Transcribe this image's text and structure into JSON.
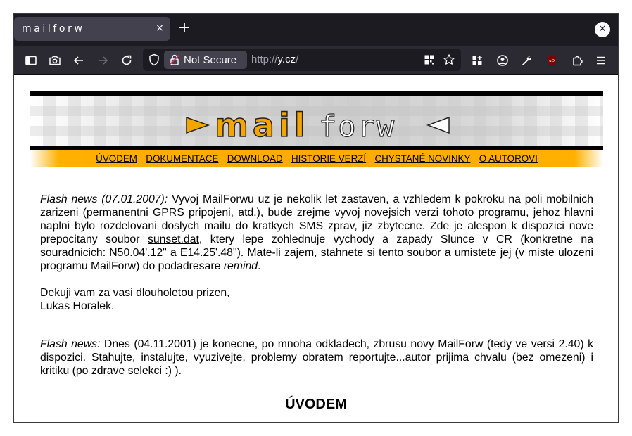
{
  "browser": {
    "tab_title": "mailforw",
    "tab_close": "×",
    "new_tab": "+",
    "window_close": "✕",
    "security_label": "Not Secure",
    "url_scheme": "http://",
    "url_host": "y.cz",
    "url_path": "/",
    "icons": [
      "sidebar-icon",
      "screenshot-icon",
      "back-icon",
      "forward-icon",
      "reload-icon",
      "shield-icon",
      "lock-icon",
      "qr-icon",
      "bookmark-star-icon",
      "extensions-grid-icon",
      "account-icon",
      "wrench-icon",
      "ublock-icon",
      "puzzle-icon",
      "menu-icon"
    ],
    "ublock_badge": "uO"
  },
  "banner": {
    "logo_bold": "mail",
    "logo_light": "forw",
    "colors": {
      "accent": "#ffaa00",
      "bar": "#000000"
    }
  },
  "menu": {
    "items": [
      "ÚVODEM",
      "DOKUMENTACE",
      "DOWNLOAD",
      "HISTORIE VERZÍ",
      "CHYSTANÉ NOVINKY",
      "O AUTOROVI"
    ]
  },
  "content": {
    "news1_label": "Flash news (07.01.2007):",
    "news1_text_a": " Vyvoj MailForwu uz je nekolik let zastaven, a vzhledem k pokroku na poli mobilnich zarizeni (permanentni GPRS pripojeni, atd.), bude zrejme vyvoj novejsich verzi tohoto programu, jehoz hlavni naplni bylo rozdelovani doslych mailu do kratkych SMS zprav, jiz zbytecne. Zde je alespon k dispozici nove prepocitany soubor ",
    "news1_link": "sunset.dat",
    "news1_text_b": ", ktery lepe zohlednuje vychody a zapady Slunce v CR (konkretne na souradnicich: N50.04'.12\" a E14.25'.48\"). Mate-li zajem, stahnete si tento soubor a umistete jej (v miste ulozeni programu MailForw) do podadresare ",
    "news1_italic": "remind",
    "news1_end": ".",
    "thanks": "Dekuji vam za vasi dlouholetou prizen,",
    "signature": "Lukas Horalek.",
    "news2_label": "Flash news:",
    "news2_text": " Dnes (04.11.2001) je konecne, po mnoha odkladech, zbrusu novy MailForw (tedy ve versi 2.40) k dispozici. Stahujte, instalujte, vyuzivejte, problemy obratem reportujte...autor prijima chvalu (bez omezeni) i kritiku (po zdrave selekci :) )."
  },
  "section_heading": "ÚVODEM"
}
